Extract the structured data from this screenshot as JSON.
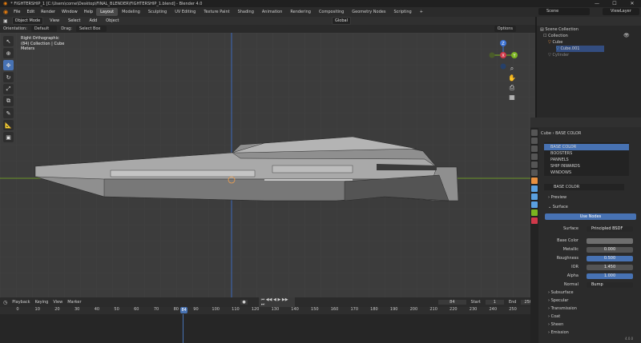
{
  "window": {
    "title": "* FIGHTERSHIP_1 [C:\\Users\\corne\\Desktop\\FINAL_BLENDER\\FIGHTERSHIP_1.blend] - Blender 4.0",
    "controls": [
      "—",
      "☐",
      "✕"
    ]
  },
  "menu": {
    "items": [
      "File",
      "Edit",
      "Render",
      "Window",
      "Help"
    ]
  },
  "workspaces": [
    "Layout",
    "Modeling",
    "Sculpting",
    "UV Editing",
    "Texture Paint",
    "Shading",
    "Animation",
    "Rendering",
    "Compositing",
    "Geometry Nodes",
    "Scripting",
    "+"
  ],
  "scene": {
    "label": "Scene",
    "view_layer": "ViewLayer"
  },
  "viewport_header": {
    "mode": "Object Mode",
    "menus": [
      "View",
      "Select",
      "Add",
      "Object"
    ],
    "transform": "Global",
    "options": "Options"
  },
  "tool_header": {
    "orientation_label": "Orientation:",
    "orientation": "Default",
    "drag_label": "Drag:",
    "drag": "Select Box"
  },
  "viewport_info": {
    "line1": "Right Orthographic",
    "line2": "(84) Collection | Cube",
    "line3": "Meters"
  },
  "gizmo": {
    "z": "Z",
    "y": "Y",
    "x": "X"
  },
  "timeline": {
    "menus": [
      "Playback",
      "Keying",
      "View",
      "Marker"
    ],
    "current": "84",
    "start_label": "Start",
    "start": "1",
    "end_label": "End",
    "end": "250",
    "ticks": [
      "0",
      "10",
      "20",
      "30",
      "40",
      "50",
      "60",
      "70",
      "80",
      "84",
      "90",
      "100",
      "110",
      "120",
      "130",
      "140",
      "150",
      "160",
      "170",
      "180",
      "190",
      "200",
      "210",
      "220",
      "230",
      "240",
      "250"
    ]
  },
  "outliner": {
    "header": "Scene Collection",
    "rows": [
      "Collection",
      "Cube",
      "Cube.001",
      "Cylinder"
    ]
  },
  "properties": {
    "breadcrumb": [
      "Cube",
      "BASE COLOR"
    ],
    "materials": [
      "BASE COLOR",
      "BOOSTERS",
      "PANNELS",
      "SHIP INWARDS",
      "WINDOWS"
    ],
    "material_name": "BASE COLOR",
    "sections": {
      "preview": "Preview",
      "surface": "Surface"
    },
    "use_nodes": "Use Nodes",
    "surface_label": "Surface",
    "surface_value": "Principled BSDF",
    "fields": [
      {
        "label": "Base Color",
        "value": ""
      },
      {
        "label": "Metallic",
        "value": "0.000"
      },
      {
        "label": "Roughness",
        "value": "0.500"
      },
      {
        "label": "IOR",
        "value": "1.450"
      },
      {
        "label": "Alpha",
        "value": "1.000"
      }
    ],
    "normal_label": "Normal",
    "normal_value": "Bump",
    "subsections": [
      "Subsurface",
      "Specular",
      "Transmission",
      "Coat",
      "Sheen",
      "Emission"
    ]
  },
  "version": "4.0.0",
  "colors": {
    "accent": "#4772b3",
    "x_axis": "#d0394a",
    "y_axis": "#7ab320",
    "z_axis": "#3d74d6"
  }
}
